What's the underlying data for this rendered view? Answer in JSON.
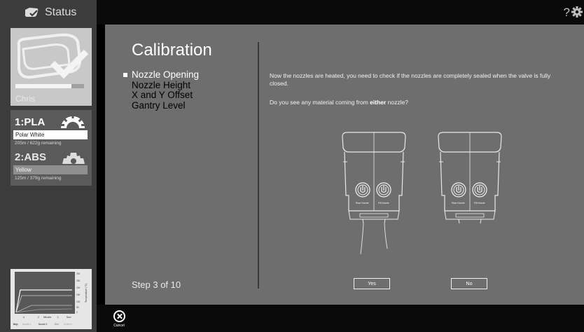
{
  "sidebar": {
    "status_label": "Status",
    "printer_name": "Chris",
    "printer_progress_fraction": 0.82,
    "materials": [
      {
        "title": "1:PLA",
        "color_name": "Polar White",
        "remaining": "205m / 622g remaining"
      },
      {
        "title": "2:ABS",
        "color_name": "Yellow",
        "remaining": "125m / 379g remaining"
      }
    ],
    "temp_chart": {
      "y_ticks": [
        "300",
        "250",
        "200",
        "150",
        "100",
        "50",
        "0"
      ],
      "ylabel": "Temperature (°C)",
      "x_ticks": [
        "-4",
        "-2",
        "Minutes",
        "-1",
        "Now"
      ],
      "legend_key": "Key:",
      "legend": [
        "Nozzle 1",
        "Nozzle 2",
        "Bed",
        "Ambient"
      ]
    }
  },
  "topbar": {
    "help_label": "?"
  },
  "calibration": {
    "title": "Calibration",
    "steps": [
      "Nozzle Opening",
      "Nozzle Height",
      "X and Y Offset",
      "Gantry Level"
    ],
    "active_step": 0,
    "step_counter": "Step 3 of 10",
    "instruction_1": "Now the nozzles are heated, you need to check if the nozzles are completely sealed when the valve is fully closed.",
    "instruction_2_pre": "Do you see any material coming from ",
    "instruction_2_bold": "either",
    "instruction_2_post": " nozzle?",
    "nozzle_labels": [
      "Rear Nozzle",
      "Fill Nozzle"
    ],
    "yes_label": "Yes",
    "no_label": "No"
  },
  "bottombar": {
    "cancel_label": "Cancel"
  }
}
